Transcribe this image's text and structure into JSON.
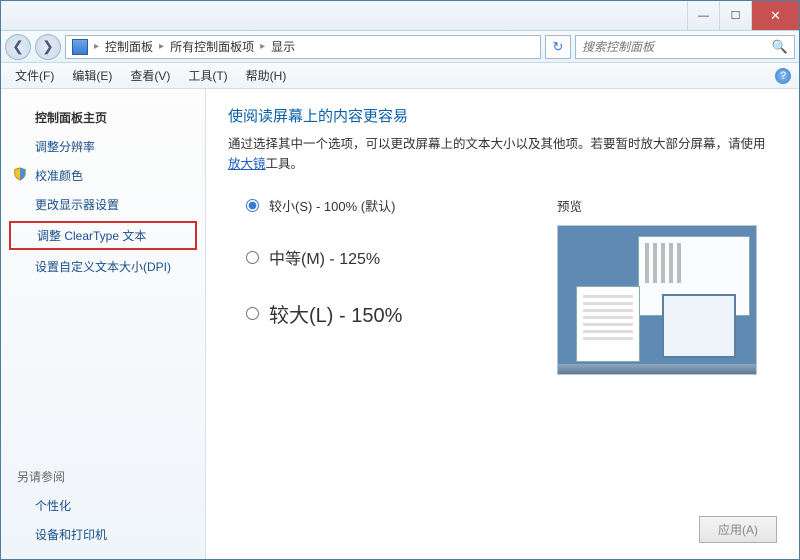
{
  "titlebar": {
    "minimize": "—",
    "maximize": "☐",
    "close": "✕"
  },
  "breadcrumb": {
    "root": "控制面板",
    "mid": "所有控制面板项",
    "leaf": "显示"
  },
  "search": {
    "placeholder": "搜索控制面板"
  },
  "menu": {
    "file": "文件(F)",
    "edit": "编辑(E)",
    "view": "查看(V)",
    "tools": "工具(T)",
    "help": "帮助(H)"
  },
  "sidebar": {
    "home": "控制面板主页",
    "adjust_res": "调整分辨率",
    "calibrate_color": "校准颜色",
    "change_display": "更改显示器设置",
    "cleartype": "调整 ClearType 文本",
    "dpi": "设置自定义文本大小(DPI)",
    "see_also": "另请参阅",
    "personalization": "个性化",
    "devices_printers": "设备和打印机"
  },
  "content": {
    "title": "使阅读屏幕上的内容更容易",
    "desc_prefix": "通过选择其中一个选项，可以更改屏幕上的文本大小以及其他项。若要暂时放大部分屏幕，请使用",
    "magnifier_link": "放大镜",
    "desc_suffix": "工具。",
    "options": {
      "small": "较小(S) - 100% (默认)",
      "medium": "中等(M) - 125%",
      "large": "较大(L) - 150%"
    },
    "preview_label": "预览",
    "apply": "应用(A)"
  }
}
